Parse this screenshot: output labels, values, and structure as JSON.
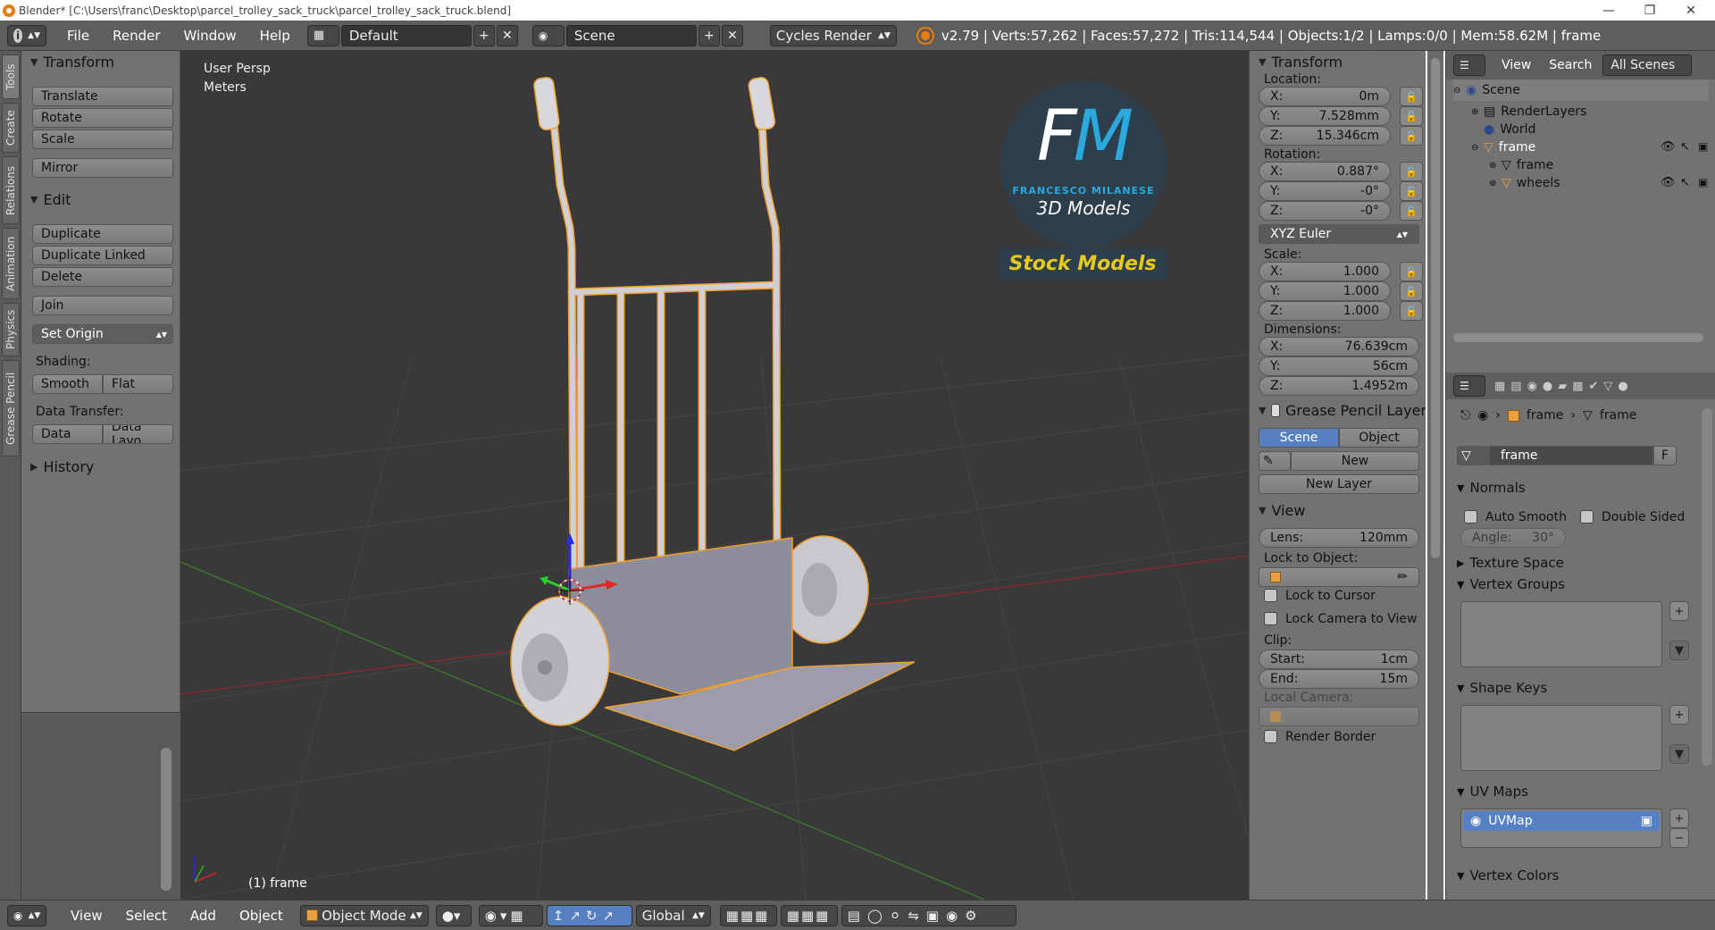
{
  "title": "Blender* [C:\\Users\\franc\\Desktop\\parcel_trolley_sack_truck\\parcel_trolley_sack_truck.blend]",
  "window_controls": {
    "minimize": "—",
    "maximize": "❐",
    "close": "✕"
  },
  "topbar": {
    "menus": [
      "File",
      "Render",
      "Window",
      "Help"
    ],
    "layout": "Default",
    "scene": "Scene",
    "engine": "Cycles Render",
    "stats": "v2.79 | Verts:57,262 | Faces:57,272 | Tris:114,544 | Objects:1/2 | Lamps:0/0 | Mem:58.62M | frame"
  },
  "side_tabs": [
    "Tools",
    "Create",
    "Relations",
    "Animation",
    "Physics",
    "Grease Pencil"
  ],
  "toolshelf": {
    "transform_title": "Transform",
    "translate": "Translate",
    "rotate": "Rotate",
    "scale": "Scale",
    "mirror": "Mirror",
    "edit_title": "Edit",
    "duplicate": "Duplicate",
    "duplicate_linked": "Duplicate Linked",
    "delete": "Delete",
    "join": "Join",
    "set_origin": "Set Origin",
    "shading_label": "Shading:",
    "smooth": "Smooth",
    "flat": "Flat",
    "data_transfer_label": "Data Transfer:",
    "data": "Data",
    "data_layout": "Data Layo",
    "history_title": "History"
  },
  "viewport": {
    "view_name": "User Persp",
    "units": "Meters",
    "object_label": "(1) frame",
    "logo_initials": "FM",
    "logo_name": "FRANCESCO MILANESE",
    "logo_sub": "3D Models",
    "logo_banner": "Stock Models"
  },
  "properties": {
    "transform_title": "Transform",
    "location_label": "Location:",
    "loc": {
      "x": "0m",
      "y": "7.528mm",
      "z": "15.346cm"
    },
    "rotation_label": "Rotation:",
    "rot": {
      "x": "0.887°",
      "y": "-0°",
      "z": "-0°"
    },
    "rotation_mode": "XYZ Euler",
    "scale_label": "Scale:",
    "scale": {
      "x": "1.000",
      "y": "1.000",
      "z": "1.000"
    },
    "dimensions_label": "Dimensions:",
    "dim": {
      "x": "76.639cm",
      "y": "56cm",
      "z": "1.4952m"
    },
    "axis_x": "X:",
    "axis_y": "Y:",
    "axis_z": "Z:",
    "grease_title": "Grease Pencil Layer",
    "scene_btn": "Scene",
    "object_btn": "Object",
    "new_btn": "New",
    "new_layer": "New Layer",
    "view_title": "View",
    "lens_label": "Lens:",
    "lens": "120mm",
    "lock_object_label": "Lock to Object:",
    "lock_cursor": "Lock to Cursor",
    "lock_camera": "Lock Camera to View",
    "clip_label": "Clip:",
    "clip_start_label": "Start:",
    "clip_start": "1cm",
    "clip_end_label": "End:",
    "clip_end": "15m",
    "local_camera": "Local Camera:",
    "render_border": "Render Border"
  },
  "outliner": {
    "view": "View",
    "search": "Search",
    "filter": "All Scenes",
    "items": [
      "Scene",
      "RenderLayers",
      "World",
      "frame",
      "frame",
      "wheels"
    ]
  },
  "propeditor": {
    "breadcrumb_obj": "frame",
    "breadcrumb_mesh": "frame",
    "mesh_name": "frame",
    "fake_user": "F",
    "normals_title": "Normals",
    "auto_smooth": "Auto Smooth",
    "double_sided": "Double Sided",
    "angle_label": "Angle:",
    "angle": "30°",
    "texture_space": "Texture Space",
    "vertex_groups": "Vertex Groups",
    "shape_keys": "Shape Keys",
    "uv_maps": "UV Maps",
    "uv_map_name": "UVMap",
    "vertex_colors": "Vertex Colors"
  },
  "bottombar": {
    "view": "View",
    "select": "Select",
    "add": "Add",
    "object": "Object",
    "mode": "Object Mode",
    "orientation": "Global"
  },
  "colors": {
    "accent_blue": "#5680c2",
    "selection_orange": "#f0a030",
    "logo_blue": "#29a9e0",
    "banner_yellow": "#e6c81e"
  }
}
